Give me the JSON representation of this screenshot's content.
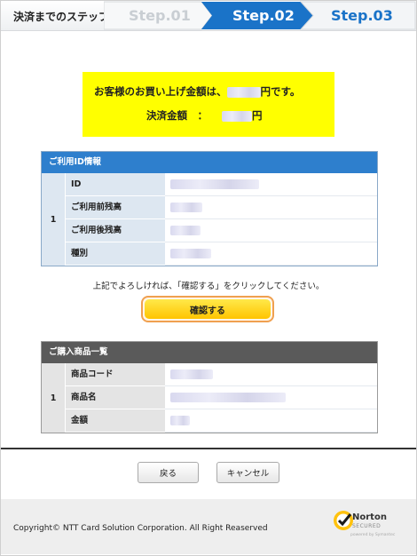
{
  "steps": {
    "title": "決済までのステップ",
    "items": [
      {
        "label": "Step.01",
        "state": "done"
      },
      {
        "label": "Step.02",
        "state": "current"
      },
      {
        "label": "Step.03",
        "state": "next"
      }
    ]
  },
  "amount": {
    "line1_prefix": "お客様のお買い上げ金額は、",
    "line1_suffix": "円です。",
    "line2_prefix": "決済金額　：",
    "line2_suffix": "円"
  },
  "id_info": {
    "title": "ご利用ID情報",
    "index": "1",
    "rows": [
      {
        "label": "ID"
      },
      {
        "label": "ご利用前残高"
      },
      {
        "label": "ご利用後残高"
      },
      {
        "label": "種別"
      }
    ]
  },
  "confirm": {
    "instruction": "上記でよろしければ、「確認する」をクリックしてください。",
    "button_label": "確認する"
  },
  "products": {
    "title": "ご購入商品一覧",
    "index": "1",
    "rows": [
      {
        "label": "商品コード"
      },
      {
        "label": "商品名"
      },
      {
        "label": "金額"
      }
    ]
  },
  "actions": {
    "back_label": "戻る",
    "cancel_label": "キャンセル"
  },
  "footer": {
    "copyright": "Copyright© NTT Card Solution Corporation. All Right Reaserved",
    "norton_name": "Norton",
    "norton_secured": "SECURED",
    "norton_by": "powered by Symantec"
  },
  "colors": {
    "step_current": "#1a73c8",
    "amount_highlight": "#ffff00",
    "id_header": "#2e7fcd",
    "product_header": "#5a5a5a",
    "confirm_button": "#ffd21e",
    "norton_check": "#ffc20e"
  }
}
